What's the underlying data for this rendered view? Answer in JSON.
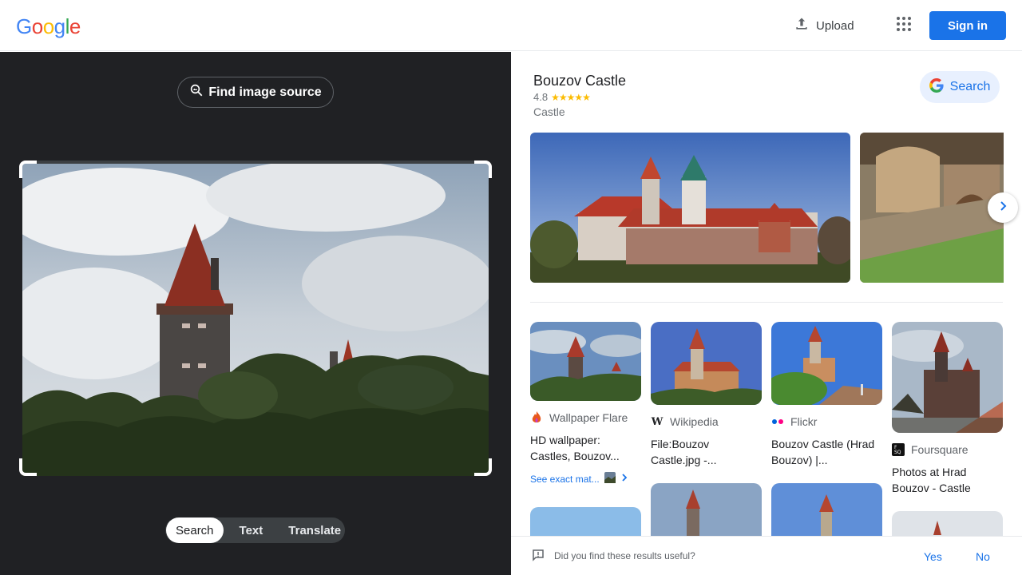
{
  "header": {
    "logo_letters": [
      {
        "ch": "G",
        "color": "#4285f4"
      },
      {
        "ch": "o",
        "color": "#ea4335"
      },
      {
        "ch": "o",
        "color": "#fbbc05"
      },
      {
        "ch": "g",
        "color": "#4285f4"
      },
      {
        "ch": "l",
        "color": "#34a853"
      },
      {
        "ch": "e",
        "color": "#ea4335"
      }
    ],
    "upload_label": "Upload",
    "signin_label": "Sign in"
  },
  "left": {
    "find_source_label": "Find image source",
    "modes": [
      "Search",
      "Text",
      "Translate"
    ],
    "active_mode": "Search"
  },
  "knowledge_panel": {
    "title": "Bouzov Castle",
    "rating": "4.8",
    "stars": "★★★★★",
    "type": "Castle",
    "search_label": "Search"
  },
  "results": [
    {
      "source": "Wallpaper Flare",
      "title": "HD wallpaper: Castles, Bouzov...",
      "exact_label": "See exact mat..."
    },
    {
      "source": "Wikipedia",
      "title": "File:Bouzov Castle.jpg -..."
    },
    {
      "source": "Flickr",
      "title": "Bouzov Castle (Hrad Bouzov) |..."
    },
    {
      "source": "Foursquare",
      "title": "Photos at Hrad Bouzov - Castle"
    }
  ],
  "feedback": {
    "question": "Did you find these results useful?",
    "yes": "Yes",
    "no": "No"
  },
  "colors": {
    "accent": "#1a73e8",
    "dark_bg": "#202124",
    "star": "#fbbc04"
  }
}
